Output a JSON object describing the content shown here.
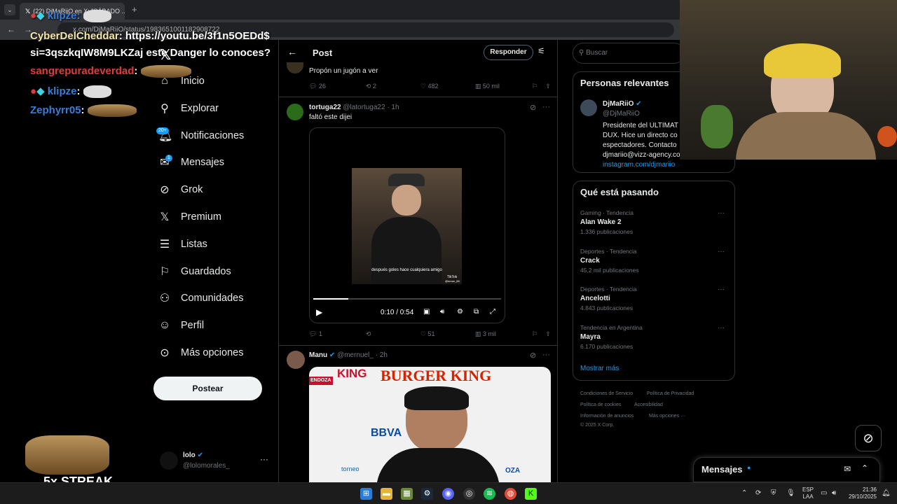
{
  "browser": {
    "tab_title": "(22) DjMaRiiO en X: \"SÁBADO ...",
    "url": "x.com/DjMaRiiO/status/1983651001182908722"
  },
  "chat": {
    "lines": [
      {
        "user": "klipze",
        "text": ""
      },
      {
        "user": "CyberDelCheddar",
        "text": ": https://youtu.be/3f1n5OEDd$"
      },
      {
        "user": "",
        "text": "si=3qszkqIW8M9LKZaj este Danger lo conoces?"
      },
      {
        "user": "sangrepuradeverdad",
        "text": ":"
      },
      {
        "user": "klipze",
        "text": ":"
      },
      {
        "user": "Zephyrr05",
        "text": ":"
      }
    ],
    "streak": "5x STREAK"
  },
  "nav": {
    "items": [
      {
        "label": "Inicio",
        "icon": "home-icon"
      },
      {
        "label": "Explorar",
        "icon": "search-icon"
      },
      {
        "label": "Notificaciones",
        "icon": "bell-icon",
        "badge": "20+"
      },
      {
        "label": "Mensajes",
        "icon": "mail-icon",
        "badge": "1"
      },
      {
        "label": "Grok",
        "icon": "grok-icon"
      },
      {
        "label": "Premium",
        "icon": "x-logo-icon"
      },
      {
        "label": "Listas",
        "icon": "list-icon"
      },
      {
        "label": "Guardados",
        "icon": "bookmark-icon"
      },
      {
        "label": "Comunidades",
        "icon": "people-icon"
      },
      {
        "label": "Perfil",
        "icon": "person-icon"
      },
      {
        "label": "Más opciones",
        "icon": "more-circle-icon"
      }
    ],
    "post_button": "Postear",
    "account": {
      "name": "lolo",
      "handle": "@lolomorales_"
    }
  },
  "header": {
    "title": "Post",
    "reply_button": "Responder"
  },
  "tweets": [
    {
      "text": "Propón un jugón a ver",
      "replies": "26",
      "retweets": "2",
      "likes": "482",
      "views": "50 mil"
    },
    {
      "name": "tortuga22",
      "handle": "@latortuga22",
      "time": "· 1h",
      "text": "faltó este dijei",
      "video": {
        "time": "0:10 / 0:54",
        "progress": 0.185,
        "caption": "después goles hace cualquiera amigo",
        "watermark": "TikTok",
        "watermark_user": "@tonan_88"
      },
      "replies": "1",
      "retweets": "",
      "likes": "51",
      "views": "3 mil"
    },
    {
      "name": "Manu",
      "handle": "@mernuel_",
      "time": "· 2h",
      "image": {
        "brand_left": "KING",
        "brand": "BURGER KING",
        "sponsor": "BBVA",
        "corner": "ENDOZA",
        "footer1": "torneo",
        "footer2": "OZA"
      }
    }
  ],
  "right": {
    "search_placeholder": "Buscar",
    "relevant": {
      "title": "Personas relevantes",
      "name": "DjMaRiiO",
      "handle": "@DjMaRiiO",
      "bio": [
        "Presidente del ULTIMAT",
        "DUX. Hice un directo co",
        "espectadores. Contacto",
        "djmariio@vizz-agency.co"
      ],
      "link": "instagram.com/djmariio"
    },
    "trends_title": "Qué está pasando",
    "trends": [
      {
        "meta": "Gaming · Tendencia",
        "name": "Alan Wake 2",
        "count": "1.336 publicaciones"
      },
      {
        "meta": "Deportes · Tendencia",
        "name": "Crack",
        "count": "45,2 mil publicaciones"
      },
      {
        "meta": "Deportes · Tendencia",
        "name": "Ancelotti",
        "count": "4.843 publicaciones"
      },
      {
        "meta": "Tendencia en Argentina",
        "name": "Mayra",
        "count": "6.170 publicaciones"
      }
    ],
    "show_more": "Mostrar más",
    "footer": {
      "row1a": "Condiciones de Servicio",
      "row1b": "Política de Privacidad",
      "row2a": "Política de cookies",
      "row2b": "Accesibilidad",
      "row3a": "Información de anuncios",
      "row3b": "Más opciones ···",
      "copyright": "© 2025 X Corp."
    },
    "messages_label": "Mensajes"
  },
  "taskbar": {
    "lang1": "ESP",
    "lang2": "LAA",
    "time": "21:36",
    "date": "29/10/2025"
  },
  "colors": {
    "accent": "#1d9bf0",
    "chat_yellow": "#f5e6a8",
    "chat_red": "#e23b3b",
    "chat_blue": "#3b7dd8"
  }
}
